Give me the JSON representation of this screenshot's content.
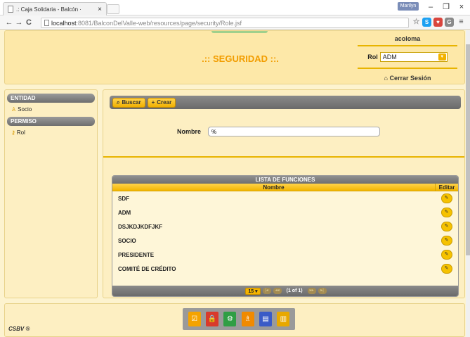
{
  "browser": {
    "tab_title": ".: Caja Solidaria - Balcón ·",
    "tab_close": "×",
    "profile_label": "Marilyn",
    "url_host": "localhost",
    "url_rest": ":8081/BalconDelValle-web/resources/page/security/Role.jsf",
    "window_buttons": [
      "–",
      "❐",
      "×"
    ],
    "nav": [
      "←",
      "→",
      "C"
    ]
  },
  "header": {
    "title": ".:: SEGURIDAD ::.",
    "username": "acoloma",
    "role_label": "Rol",
    "role_value": "ADM",
    "logout_label": "Cerrar Sesión"
  },
  "sidebar": {
    "sections": [
      {
        "title": "ENTIDAD",
        "items": [
          {
            "label": "Socio",
            "icon": "users-icon"
          }
        ]
      },
      {
        "title": "PERMISO",
        "items": [
          {
            "label": "Rol",
            "icon": "key-icon"
          }
        ]
      }
    ]
  },
  "toolbar": {
    "search_label": "Buscar",
    "create_label": "Crear"
  },
  "form": {
    "nombre_label": "Nombre",
    "nombre_value": "%"
  },
  "grid": {
    "caption": "LISTA DE FUNCIONES",
    "col_name": "Nombre",
    "col_edit": "Editar",
    "rows": [
      "SDF",
      "ADM",
      "DSJKDJKDFJKF",
      "SOCIO",
      "PRESIDENTE",
      "COMITÉ DE CRÉDITO"
    ],
    "rows_per_page": "15 ▾",
    "page_text": "(1 of 1)"
  },
  "footer": {
    "copyright": "CSBV ®"
  },
  "colors": {
    "accent": "#f2b400",
    "title": "#f29d00",
    "background": "#fdefc2"
  }
}
